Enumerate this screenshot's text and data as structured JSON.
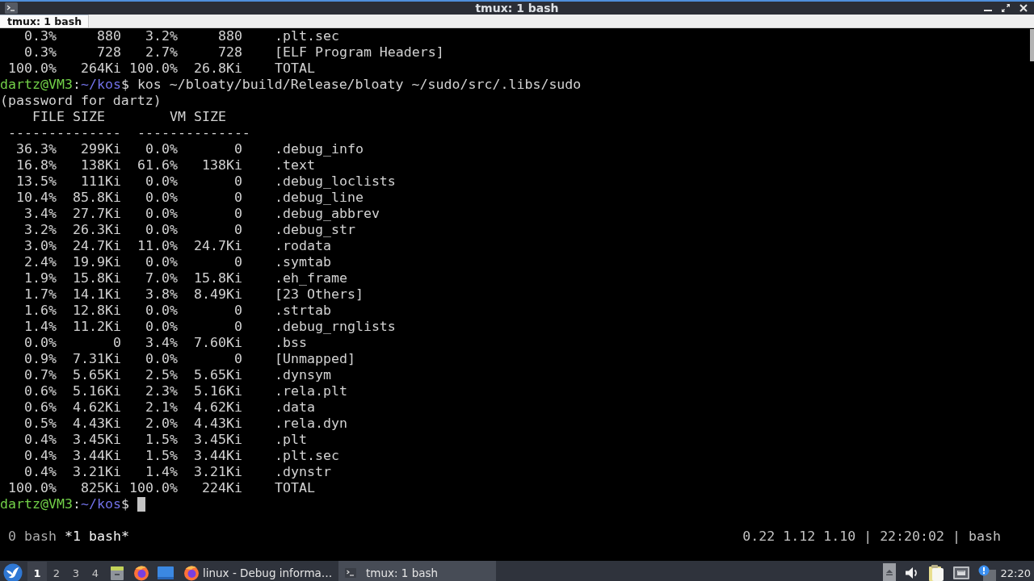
{
  "window": {
    "title": "tmux: 1 bash"
  },
  "tabs": [
    {
      "label": "tmux: 1 bash",
      "selected": true
    }
  ],
  "terminal": {
    "lines": [
      {
        "kind": "row",
        "cells": [
          "0.3%",
          "880",
          "3.2%",
          "880",
          ".plt.sec"
        ]
      },
      {
        "kind": "row",
        "cells": [
          "0.3%",
          "728",
          "2.7%",
          "728",
          "[ELF Program Headers]"
        ]
      },
      {
        "kind": "row",
        "cells": [
          "100.0%",
          "264Ki",
          "100.0%",
          "26.8Ki",
          "TOTAL"
        ]
      },
      {
        "kind": "prompt",
        "user_host": "dartz@VM3",
        "separator": ":",
        "path": "~/kos",
        "symbol": "$",
        "command": "kos ~/bloaty/build/Release/bloaty ~/sudo/src/.libs/sudo",
        "cursor": false
      },
      {
        "kind": "text",
        "text": "(password for dartz)"
      },
      {
        "kind": "header",
        "cells": [
          "FILE SIZE",
          "VM SIZE"
        ]
      },
      {
        "kind": "rule",
        "cells": [
          "--------------",
          "--------------"
        ]
      },
      {
        "kind": "row",
        "cells": [
          "36.3%",
          "299Ki",
          "0.0%",
          "0",
          ".debug_info"
        ]
      },
      {
        "kind": "row",
        "cells": [
          "16.8%",
          "138Ki",
          "61.6%",
          "138Ki",
          ".text"
        ]
      },
      {
        "kind": "row",
        "cells": [
          "13.5%",
          "111Ki",
          "0.0%",
          "0",
          ".debug_loclists"
        ]
      },
      {
        "kind": "row",
        "cells": [
          "10.4%",
          "85.8Ki",
          "0.0%",
          "0",
          ".debug_line"
        ]
      },
      {
        "kind": "row",
        "cells": [
          "3.4%",
          "27.7Ki",
          "0.0%",
          "0",
          ".debug_abbrev"
        ]
      },
      {
        "kind": "row",
        "cells": [
          "3.2%",
          "26.3Ki",
          "0.0%",
          "0",
          ".debug_str"
        ]
      },
      {
        "kind": "row",
        "cells": [
          "3.0%",
          "24.7Ki",
          "11.0%",
          "24.7Ki",
          ".rodata"
        ]
      },
      {
        "kind": "row",
        "cells": [
          "2.4%",
          "19.9Ki",
          "0.0%",
          "0",
          ".symtab"
        ]
      },
      {
        "kind": "row",
        "cells": [
          "1.9%",
          "15.8Ki",
          "7.0%",
          "15.8Ki",
          ".eh_frame"
        ]
      },
      {
        "kind": "row",
        "cells": [
          "1.7%",
          "14.1Ki",
          "3.8%",
          "8.49Ki",
          "[23 Others]"
        ]
      },
      {
        "kind": "row",
        "cells": [
          "1.6%",
          "12.8Ki",
          "0.0%",
          "0",
          ".strtab"
        ]
      },
      {
        "kind": "row",
        "cells": [
          "1.4%",
          "11.2Ki",
          "0.0%",
          "0",
          ".debug_rnglists"
        ]
      },
      {
        "kind": "row",
        "cells": [
          "0.0%",
          "0",
          "3.4%",
          "7.60Ki",
          ".bss"
        ]
      },
      {
        "kind": "row",
        "cells": [
          "0.9%",
          "7.31Ki",
          "0.0%",
          "0",
          "[Unmapped]"
        ]
      },
      {
        "kind": "row",
        "cells": [
          "0.7%",
          "5.65Ki",
          "2.5%",
          "5.65Ki",
          ".dynsym"
        ]
      },
      {
        "kind": "row",
        "cells": [
          "0.6%",
          "5.16Ki",
          "2.3%",
          "5.16Ki",
          ".rela.plt"
        ]
      },
      {
        "kind": "row",
        "cells": [
          "0.6%",
          "4.62Ki",
          "2.1%",
          "4.62Ki",
          ".data"
        ]
      },
      {
        "kind": "row",
        "cells": [
          "0.5%",
          "4.43Ki",
          "2.0%",
          "4.43Ki",
          ".rela.dyn"
        ]
      },
      {
        "kind": "row",
        "cells": [
          "0.4%",
          "3.45Ki",
          "1.5%",
          "3.45Ki",
          ".plt"
        ]
      },
      {
        "kind": "row",
        "cells": [
          "0.4%",
          "3.44Ki",
          "1.5%",
          "3.44Ki",
          ".plt.sec"
        ]
      },
      {
        "kind": "row",
        "cells": [
          "0.4%",
          "3.21Ki",
          "1.4%",
          "3.21Ki",
          ".dynstr"
        ]
      },
      {
        "kind": "row",
        "cells": [
          "100.0%",
          "825Ki",
          "100.0%",
          "224Ki",
          "TOTAL"
        ]
      },
      {
        "kind": "prompt",
        "user_host": "dartz@VM3",
        "separator": ":",
        "path": "~/kos",
        "symbol": "$",
        "cursor": true
      }
    ]
  },
  "tmux_status": {
    "windows": [
      {
        "label": "0 bash",
        "selected": false
      },
      {
        "label": "*1 bash*",
        "selected": true
      }
    ],
    "right": "0.22 1.12 1.10 | 22:20:02 | bash"
  },
  "taskbar": {
    "workspaces": [
      {
        "label": "1",
        "selected": true
      },
      {
        "label": "2",
        "selected": false
      },
      {
        "label": "3",
        "selected": false
      },
      {
        "label": "4",
        "selected": false
      }
    ],
    "tasks": [
      {
        "kind": "browser",
        "label": "linux - Debug informa…",
        "selected": false
      },
      {
        "kind": "terminal",
        "label": "tmux: 1 bash",
        "selected": true
      }
    ],
    "clock": "22:20"
  }
}
